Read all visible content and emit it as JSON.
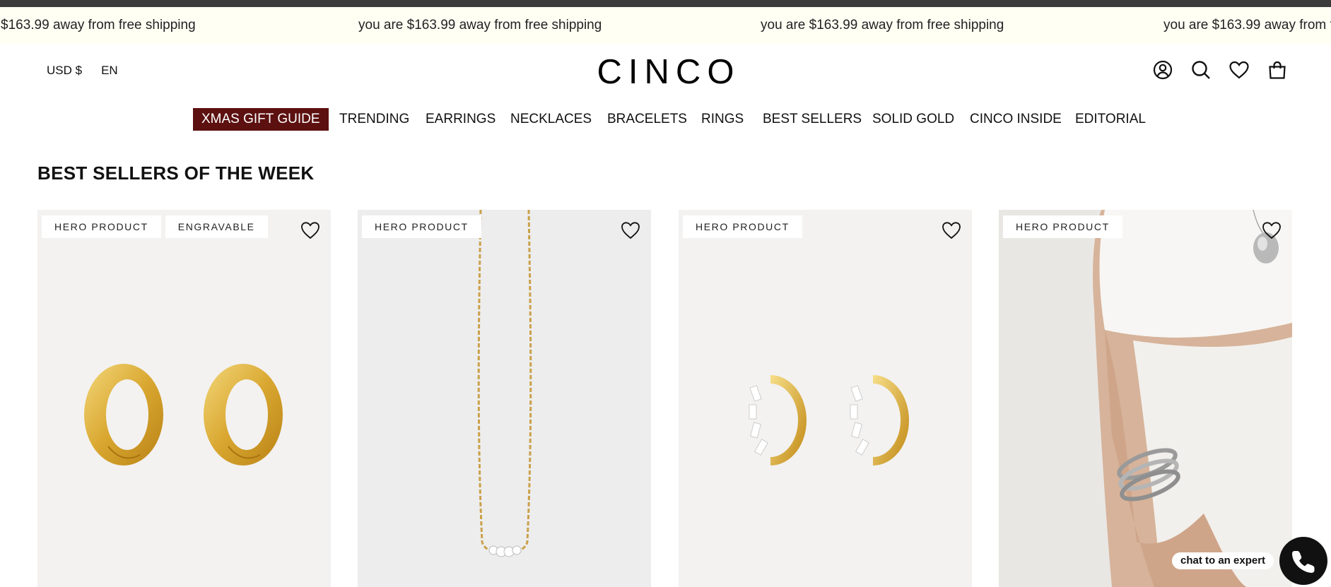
{
  "announcement": {
    "message": "you are $163.99 away from free shipping",
    "message_partial": "$163.99 away from free shipping"
  },
  "header": {
    "currency": "USD $",
    "language": "EN",
    "logo": "CINCO",
    "icons": [
      "account-icon",
      "search-icon",
      "wishlist-heart-icon",
      "cart-bag-icon"
    ]
  },
  "nav": {
    "items": [
      "XMAS GIFT GUIDE",
      "TRENDING",
      "EARRINGS",
      "NECKLACES",
      "BRACELETS",
      "RINGS",
      "BEST SELLERS",
      "SOLID GOLD",
      "CINCO INSIDE",
      "EDITORIAL"
    ],
    "feature_color": "#5c1010"
  },
  "section": {
    "title": "BEST SELLERS OF THE WEEK"
  },
  "products": [
    {
      "badges": [
        "HERO PRODUCT",
        "ENGRAVABLE"
      ],
      "image": "gold engraved hoop earrings"
    },
    {
      "badges": [
        "HERO PRODUCT"
      ],
      "image": "gold chain necklace with crystals"
    },
    {
      "badges": [
        "HERO PRODUCT"
      ],
      "image": "gold huggie earrings with baguette stones"
    },
    {
      "badges": [
        "HERO PRODUCT"
      ],
      "image": "model wearing silver bangles and pendant"
    }
  ],
  "chat": {
    "label": "chat to an expert",
    "icon": "phone-icon"
  }
}
